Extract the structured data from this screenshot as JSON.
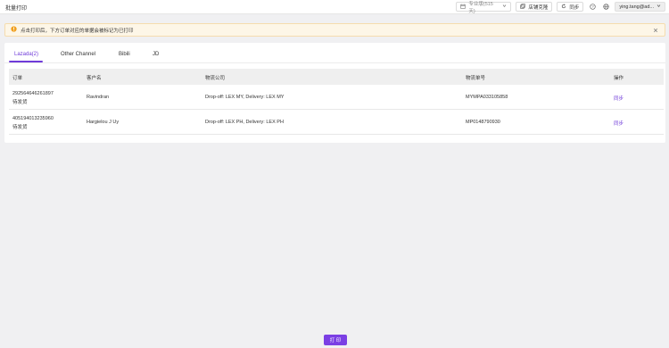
{
  "app": {
    "title": "批量打印"
  },
  "header": {
    "plan_label": "专业版(515 天)",
    "shop_clone_label": "店铺克隆",
    "sync_label": "同步",
    "user_label": "ying.tang@ad..."
  },
  "alert": {
    "text": "点击打印后，下方订单对应的单据会被标记为已打印"
  },
  "tabs": [
    {
      "label": "Lazada(2)",
      "active": true
    },
    {
      "label": "Other Channel",
      "active": false
    },
    {
      "label": "Bibili",
      "active": false
    },
    {
      "label": "JD",
      "active": false
    }
  ],
  "table": {
    "columns": [
      "订单",
      "客户名",
      "物流公司",
      "物流单号",
      "操作"
    ],
    "rows": [
      {
        "order_no": "292564646261897",
        "status": "待发货",
        "customer": "Ravindran",
        "logistics": "Drop-off: LEX MY, Delivery: LEX MY",
        "tracking": "MYMPA033105858",
        "action": "同步"
      },
      {
        "order_no": "405194013235960",
        "status": "待发货",
        "customer": "Hargielou J Uy",
        "logistics": "Drop-off: LEX PH, Delivery: LEX PH",
        "tracking": "MP0148790930",
        "action": "同步"
      }
    ]
  },
  "footer": {
    "print_label": "打 印"
  },
  "colors": {
    "accent": "#6f3bd9",
    "alert_bg": "#fdf6e7",
    "alert_icon": "#f0a020"
  }
}
